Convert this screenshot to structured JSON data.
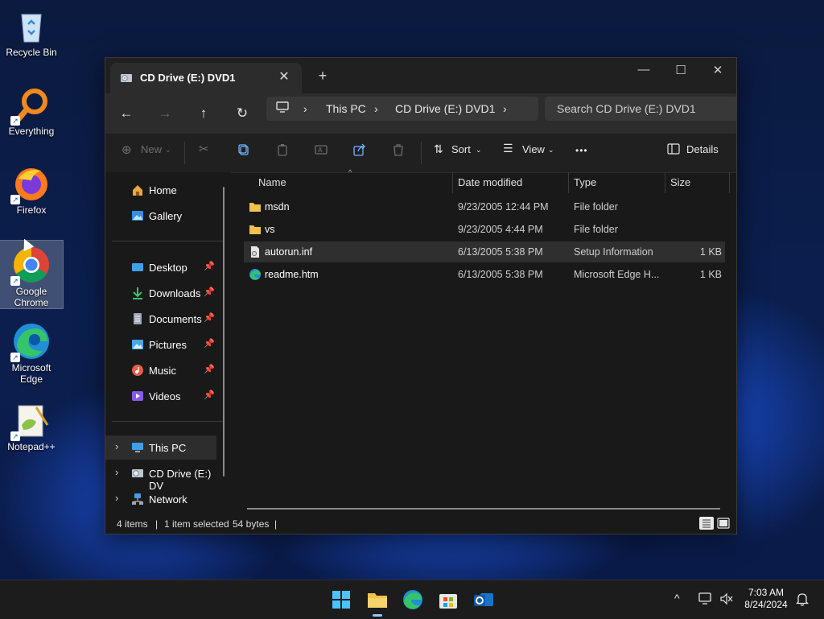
{
  "desktop": {
    "icons": [
      {
        "label": "Recycle Bin",
        "icon": "recycle-bin-icon"
      },
      {
        "label": "Everything",
        "icon": "everything-search-icon"
      },
      {
        "label": "Firefox",
        "icon": "firefox-icon"
      },
      {
        "label": "Google Chrome",
        "icon": "chrome-icon"
      },
      {
        "label": "Microsoft Edge",
        "icon": "edge-icon"
      },
      {
        "label": "Notepad++",
        "icon": "notepadpp-icon"
      }
    ]
  },
  "window": {
    "tab_title": "CD Drive (E:) DVD1",
    "tab_close": "✕",
    "new_tab": "+",
    "controls": {
      "minimize": "—",
      "maximize": "☐",
      "close": "✕"
    },
    "nav": {
      "back": "←",
      "forward": "→",
      "up": "↑",
      "refresh": "↻"
    },
    "address": {
      "segments": [
        "This PC",
        "CD Drive (E:) DVD1"
      ],
      "sep": "›"
    },
    "search_placeholder": "Search CD Drive (E:) DVD1",
    "toolbar": {
      "new_label": "New",
      "sort_label": "Sort",
      "view_label": "View",
      "more_label": "•••",
      "details_label": "Details"
    },
    "sidebar": {
      "top": [
        {
          "label": "Home",
          "icon": "home-icon"
        },
        {
          "label": "Gallery",
          "icon": "gallery-icon"
        }
      ],
      "pinned": [
        {
          "label": "Desktop",
          "icon": "desktop-folder-icon",
          "color": "#3ea0e8"
        },
        {
          "label": "Downloads",
          "icon": "downloads-icon",
          "color": "#3fbf6a"
        },
        {
          "label": "Documents",
          "icon": "documents-icon",
          "color": "#9aa7b8"
        },
        {
          "label": "Pictures",
          "icon": "pictures-icon",
          "color": "#4aa6e8"
        },
        {
          "label": "Music",
          "icon": "music-icon",
          "color": "#e0604a"
        },
        {
          "label": "Videos",
          "icon": "videos-icon",
          "color": "#8a5ae0"
        }
      ],
      "tree": [
        {
          "label": "This PC",
          "icon": "this-pc-icon"
        },
        {
          "label": "CD Drive (E:) DV",
          "icon": "cd-drive-icon"
        },
        {
          "label": "Network",
          "icon": "network-icon"
        }
      ]
    },
    "columns": {
      "name": "Name",
      "date": "Date modified",
      "type": "Type",
      "size": "Size"
    },
    "files": [
      {
        "name": "msdn",
        "date": "9/23/2005 12:44 PM",
        "type": "File folder",
        "size": "",
        "icon": "folder-icon"
      },
      {
        "name": "vs",
        "date": "9/23/2005 4:44 PM",
        "type": "File folder",
        "size": "",
        "icon": "folder-icon"
      },
      {
        "name": "autorun.inf",
        "date": "6/13/2005 5:38 PM",
        "type": "Setup Information",
        "size": "1 KB",
        "icon": "inf-file-icon",
        "selected": true
      },
      {
        "name": "readme.htm",
        "date": "6/13/2005 5:38 PM",
        "type": "Microsoft Edge H...",
        "size": "1 KB",
        "icon": "edge-html-file-icon"
      }
    ],
    "status": {
      "items": "4 items",
      "selected": "1 item selected",
      "size": "54 bytes",
      "sep": "|"
    }
  },
  "taskbar": {
    "clock_time": "7:03 AM",
    "clock_date": "8/24/2024",
    "chevron": "^"
  }
}
